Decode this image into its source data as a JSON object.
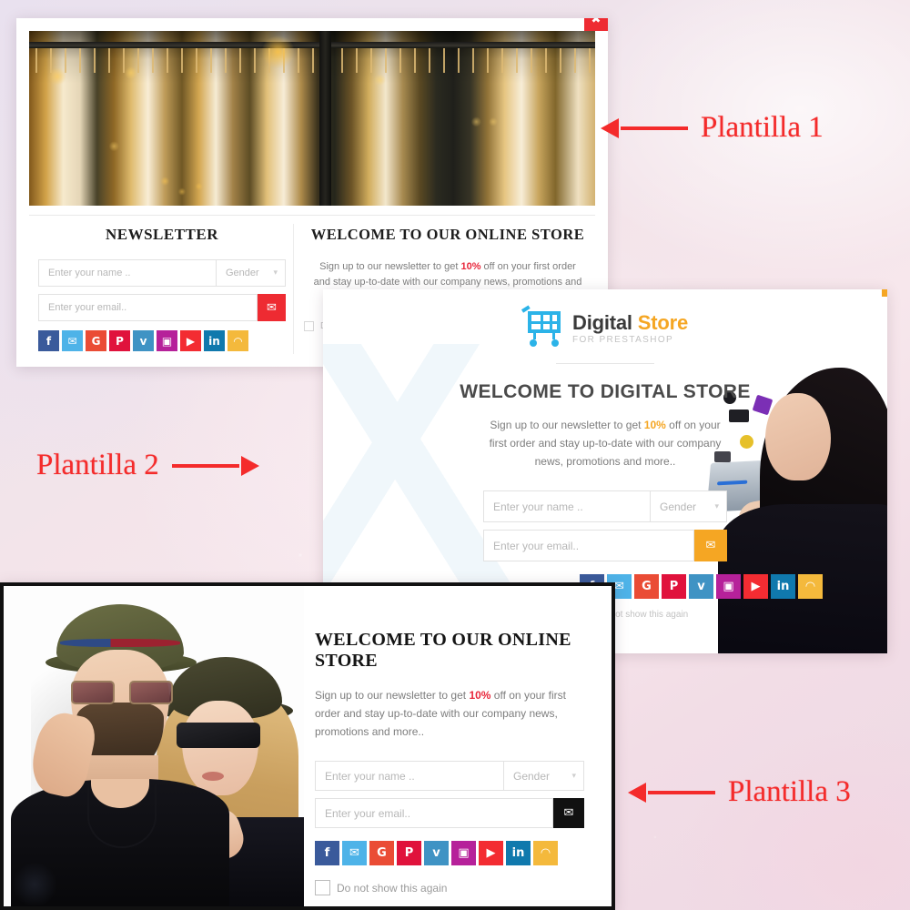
{
  "annotations": [
    {
      "label": "Plantilla 1",
      "arrow": "left"
    },
    {
      "label": "Plantilla 2",
      "arrow": "right"
    },
    {
      "label": "Plantilla 3",
      "arrow": "left"
    }
  ],
  "common": {
    "name_placeholder": "Enter your name ..",
    "email_placeholder": "Enter your email..",
    "gender_label": "Gender",
    "do_not_show_label": "Do not show this again",
    "send_icon": "envelope-icon",
    "close_icon": "close-icon",
    "caret_icon": "chevron-down-icon"
  },
  "socials": [
    {
      "name": "facebook",
      "glyph": "f",
      "color": "#3a5a9b"
    },
    {
      "name": "twitter",
      "glyph": "✉",
      "color": "#4eb3e8"
    },
    {
      "name": "google-plus",
      "glyph": "G",
      "color": "#ea4c35"
    },
    {
      "name": "pinterest",
      "glyph": "P",
      "color": "#e0123c"
    },
    {
      "name": "vimeo",
      "glyph": "v",
      "color": "#3f93c4"
    },
    {
      "name": "instagram",
      "glyph": "▣",
      "color": "#b6219a"
    },
    {
      "name": "youtube",
      "glyph": "▶",
      "color": "#f32c32"
    },
    {
      "name": "linkedin",
      "glyph": "in",
      "color": "#1079ad"
    },
    {
      "name": "rss",
      "glyph": "◠",
      "color": "#f4b93c"
    }
  ],
  "panel1": {
    "close_color": "#ee2b32",
    "hero_image": "clothing-rack-boutique-photo",
    "left": {
      "title": "NEWSLETTER",
      "send_button_color": "#ee2b32"
    },
    "right": {
      "title": "WELCOME TO OUR ONLINE STORE",
      "desc_before": "Sign up to our newsletter to get ",
      "desc_highlight": "10%",
      "desc_after": " off on your first order and stay up-to-date with our company news, promotions and more..",
      "highlight_color": "#e8283c"
    }
  },
  "panel2": {
    "close_color": "#f5a623",
    "brand_primary": "Digital",
    "brand_accent": "Store",
    "brand_sub": "FOR PRESTASHOP",
    "brand_accent_color": "#f5a623",
    "logo_icon": "shopping-cart-icon",
    "title": "WELCOME TO DIGITAL STORE",
    "desc_before": "Sign up to our newsletter to get ",
    "desc_highlight": "10%",
    "desc_after": " off on your first order and stay up-to-date with our company news, promotions and more..",
    "send_button_color": "#f5a623",
    "photo": "woman-holding-laptop-with-devices-photo"
  },
  "panel3": {
    "close_color": "#111111",
    "title": "WELCOME TO OUR ONLINE STORE",
    "desc_before": "Sign up to our newsletter to get ",
    "desc_highlight": "10%",
    "desc_after": " off on your first order and stay up-to-date with our company news, promotions and more..",
    "send_button_color": "#111111",
    "photo": "couple-with-hats-and-sunglasses-photo"
  }
}
